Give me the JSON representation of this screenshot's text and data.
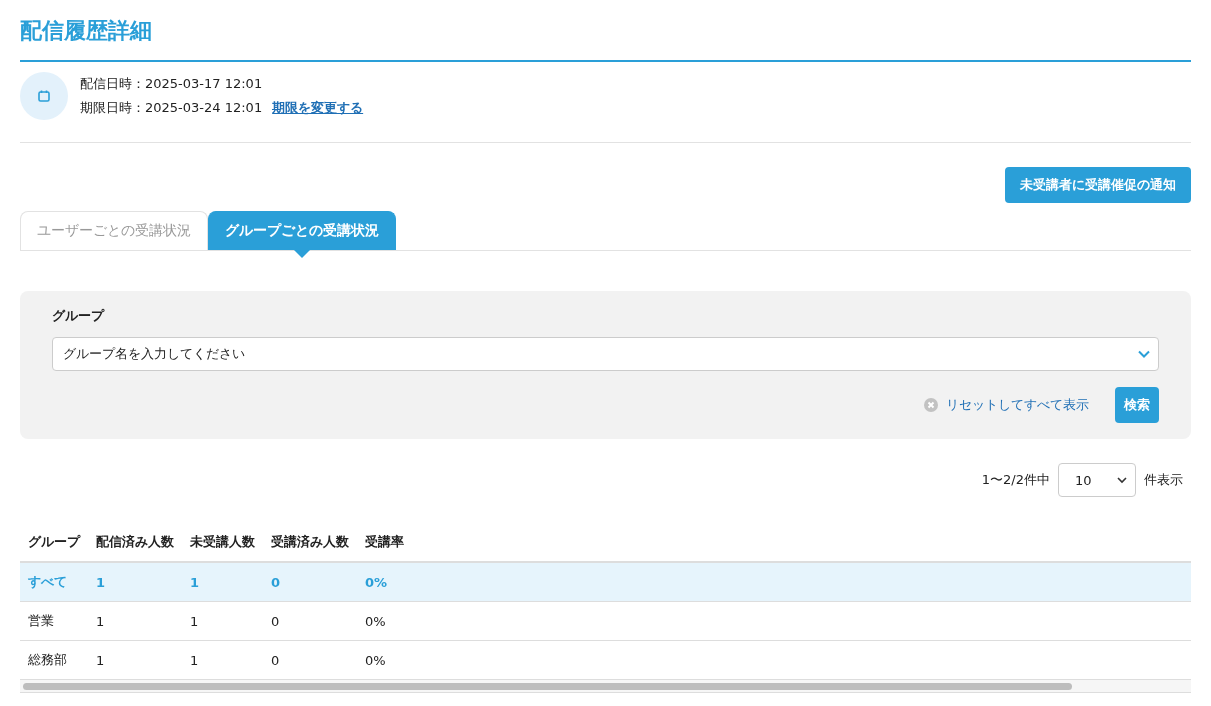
{
  "page_title": "配信履歴詳細",
  "info": {
    "delivered": "配信日時：2025-03-17 12:01",
    "deadline": "期限日時：2025-03-24 12:01",
    "change_link": "期限を変更する"
  },
  "notify_button": "未受講者に受講催促の通知",
  "tabs": [
    {
      "label": "ユーザーごとの受講状況",
      "selected": false
    },
    {
      "label": "グループごとの受講状況",
      "selected": true
    }
  ],
  "filter": {
    "label": "グループ",
    "placeholder": "グループ名を入力してください",
    "reset": "リセットしてすべて表示",
    "search": "検索"
  },
  "pagination": {
    "range": "1〜2/2件中",
    "per_page": "10",
    "suffix": "件表示"
  },
  "table": {
    "columns": [
      "グループ",
      "配信済み人数",
      "未受講人数",
      "受講済み人数",
      "受講率"
    ],
    "rows": [
      {
        "cells": [
          "すべて",
          "1",
          "1",
          "0",
          "0%"
        ],
        "selected": true
      },
      {
        "cells": [
          "営業",
          "1",
          "1",
          "0",
          "0%"
        ],
        "selected": false
      },
      {
        "cells": [
          "総務部",
          "1",
          "1",
          "0",
          "0%"
        ],
        "selected": false
      }
    ]
  }
}
